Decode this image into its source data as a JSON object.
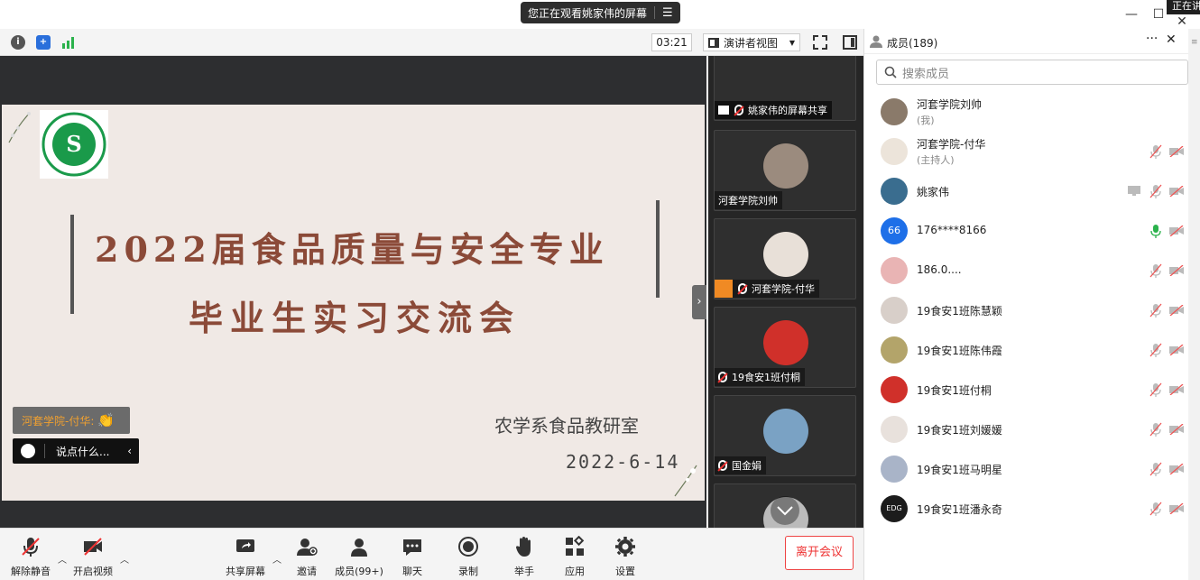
{
  "window": {
    "banner_text": "您正在观看姚家伟的屏幕",
    "banner_menu_icon": "menu-icon",
    "corner_tag": "正在讲"
  },
  "toolbar": {
    "timer": "03:21",
    "view_mode": "演讲者视图"
  },
  "slide": {
    "title_line1": "2022届食品质量与安全专业",
    "title_line2": "毕业生实习交流会",
    "department": "农学系食品教研室",
    "date": "2022-6-14",
    "logo_text_top": "河套学院",
    "logo_text_bottom": "HETAO COLLEGE"
  },
  "reaction": {
    "text": "河套学院-付华:",
    "emoji": "👏"
  },
  "chat": {
    "placeholder": "说点什么..."
  },
  "video_tiles": [
    {
      "name": "姚家伟的屏幕共享",
      "color": "#3a6d8f"
    },
    {
      "name": "河套学院刘帅",
      "color": "#9b8b7e"
    },
    {
      "name": "河套学院-付华",
      "color": "#e8e0d8"
    },
    {
      "name": "19食安1班付桐",
      "color": "#d0302a"
    },
    {
      "name": "国金娟",
      "color": "#7aa2c4"
    },
    {
      "name": "",
      "color": "#bbbbbb"
    }
  ],
  "controls": {
    "unmute": "解除静音",
    "start_video": "开启视频",
    "share_screen": "共享屏幕",
    "invite": "邀请",
    "members": "成员(99+)",
    "chat": "聊天",
    "record": "录制",
    "raise_hand": "举手",
    "apps": "应用",
    "settings": "设置",
    "leave": "离开会议"
  },
  "panel": {
    "title": "成员(189)",
    "search_placeholder": "搜索成员",
    "members": [
      {
        "name": "河套学院刘帅",
        "role": "(我)",
        "avatar_color": "#8a7a6a",
        "avatar_text": "",
        "mic": "none",
        "cam": "none"
      },
      {
        "name": "河套学院-付华",
        "role": "(主持人)",
        "avatar_color": "#ece4da",
        "avatar_text": "",
        "mic": "muted",
        "cam": "off"
      },
      {
        "name": "姚家伟",
        "role": "",
        "avatar_color": "#3a6d8f",
        "avatar_text": "",
        "mic": "muted",
        "cam": "off",
        "sharing": true
      },
      {
        "name": "176****8166",
        "role": "",
        "avatar_color": "#1e6fe8",
        "avatar_text": "66",
        "mic": "on",
        "cam": "off"
      },
      {
        "name": "186.0....",
        "role": "",
        "avatar_color": "#e9b4b4",
        "avatar_text": "",
        "mic": "muted",
        "cam": "off"
      },
      {
        "name": "19食安1班陈慧颖",
        "role": "",
        "avatar_color": "#d8cfc9",
        "avatar_text": "",
        "mic": "muted",
        "cam": "off"
      },
      {
        "name": "19食安1班陈伟霞",
        "role": "",
        "avatar_color": "#b3a46a",
        "avatar_text": "",
        "mic": "muted",
        "cam": "off"
      },
      {
        "name": "19食安1班付桐",
        "role": "",
        "avatar_color": "#d0302a",
        "avatar_text": "",
        "mic": "muted",
        "cam": "off"
      },
      {
        "name": "19食安1班刘媛媛",
        "role": "",
        "avatar_color": "#e8e1dc",
        "avatar_text": "",
        "mic": "muted",
        "cam": "off"
      },
      {
        "name": "19食安1班马明星",
        "role": "",
        "avatar_color": "#a9b4c8",
        "avatar_text": "",
        "mic": "muted",
        "cam": "off"
      },
      {
        "name": "19食安1班潘永奇",
        "role": "",
        "avatar_color": "#1c1c1c",
        "avatar_text": "EDG",
        "mic": "muted",
        "cam": "off"
      }
    ]
  }
}
